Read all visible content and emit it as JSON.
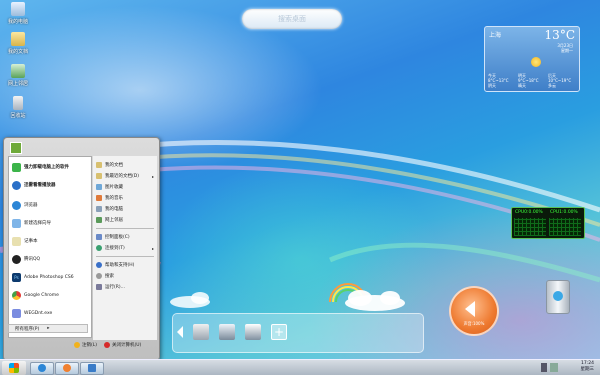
{
  "desktop_icons": [
    {
      "label": "我的电脑"
    },
    {
      "label": "我的文档"
    },
    {
      "label": "网上邻居"
    },
    {
      "label": "回收站"
    }
  ],
  "search_placeholder": "搜索桌面",
  "weather": {
    "city": "上海",
    "temperature": "13°C",
    "date_line1": "3月23日",
    "date_line2": "星期一",
    "forecast": [
      {
        "day": "今天",
        "cond": "阴天",
        "temp": "8°C~13°C"
      },
      {
        "day": "明天",
        "cond": "晴天",
        "temp": "9°C~18°C"
      },
      {
        "day": "后天",
        "cond": "多云",
        "temp": "10°C~19°C"
      }
    ]
  },
  "cpu_meter": {
    "cpu0": "CPU0:0.00%",
    "cpu1": "CPU1:0.00%"
  },
  "volume_widget": {
    "label": "声音:100%"
  },
  "start_menu": {
    "left_items": [
      {
        "label": "强力卸载电脑上的软件"
      },
      {
        "label": "迅雷看看播放器"
      },
      {
        "label": "浏览器"
      },
      {
        "label": "新建选择向导"
      },
      {
        "label": "记事本"
      },
      {
        "label": "腾讯QQ"
      },
      {
        "label": "Adobe Photoshop CS6"
      },
      {
        "label": "Google Chrome"
      },
      {
        "label": "WEGDnt.exe"
      }
    ],
    "all_programs": "所有程序(P)",
    "right_items": [
      {
        "label": "我的文档"
      },
      {
        "label": "我最近的文档(D)",
        "arrow": "▸"
      },
      {
        "label": "图片收藏"
      },
      {
        "label": "我的音乐"
      },
      {
        "label": "我的电脑"
      },
      {
        "label": "网上邻居"
      },
      {
        "label": "控制面板(C)"
      },
      {
        "label": "连接到(T)",
        "arrow": "▸"
      },
      {
        "label": "帮助和支持(H)"
      },
      {
        "label": "搜索"
      },
      {
        "label": "运行(R)..."
      }
    ],
    "logoff": "注销(L)",
    "shutdown": "关闭计算机(U)"
  },
  "clock": {
    "time": "17:24",
    "date": "星期三"
  },
  "colors": {
    "accent": "#2e86e0",
    "start_orb": "#3a8ee0"
  }
}
